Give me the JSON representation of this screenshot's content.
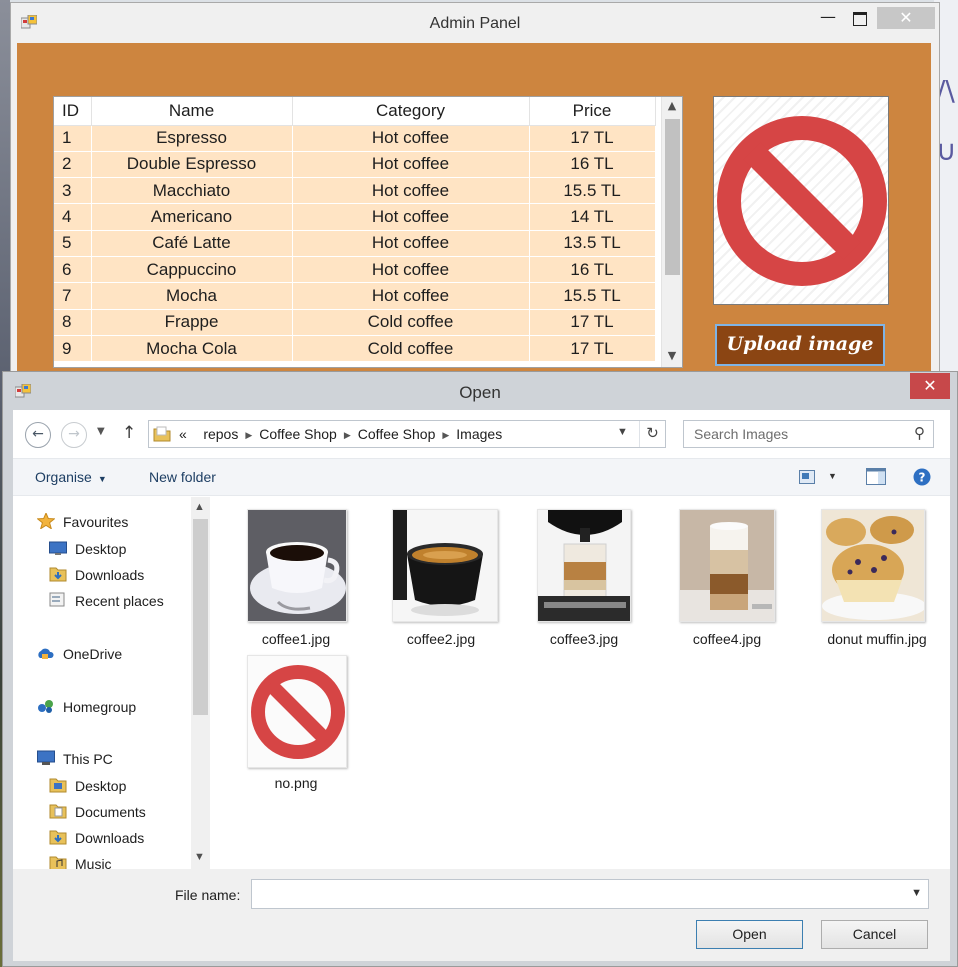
{
  "admin_window": {
    "title": "Admin Panel",
    "grid": {
      "columns": [
        "ID",
        "Name",
        "Category",
        "Price"
      ],
      "rows": [
        [
          "1",
          "Espresso",
          "Hot coffee",
          "17 TL"
        ],
        [
          "2",
          "Double Espresso",
          "Hot coffee",
          "16 TL"
        ],
        [
          "3",
          "Macchiato",
          "Hot coffee",
          "15.5 TL"
        ],
        [
          "4",
          "Americano",
          "Hot coffee",
          "14 TL"
        ],
        [
          "5",
          "Café Latte",
          "Hot coffee",
          "13.5 TL"
        ],
        [
          "6",
          "Cappuccino",
          "Hot coffee",
          "16 TL"
        ],
        [
          "7",
          "Mocha",
          "Hot coffee",
          "15.5 TL"
        ],
        [
          "8",
          "Frappe",
          "Cold coffee",
          "17 TL"
        ],
        [
          "9",
          "Mocha Cola",
          "Cold coffee",
          "17 TL"
        ]
      ]
    },
    "picture_icon": "no-entry-icon",
    "upload_label": "Upload image",
    "colors": {
      "panel": "#cd853f",
      "row": "#ffe4c4",
      "button": "#8b4513"
    }
  },
  "open_dialog": {
    "title": "Open",
    "breadcrumb": {
      "overflow": "«",
      "parts": [
        "repos",
        "Coffee Shop",
        "Coffee Shop",
        "Images"
      ]
    },
    "search_placeholder": "Search Images",
    "toolbar": {
      "organise": "Organise",
      "new_folder": "New folder"
    },
    "nav": {
      "favourites": "Favourites",
      "desktop": "Desktop",
      "downloads": "Downloads",
      "recent": "Recent places",
      "onedrive": "OneDrive",
      "homegroup": "Homegroup",
      "this_pc": "This PC",
      "pc_desktop": "Desktop",
      "pc_documents": "Documents",
      "pc_downloads": "Downloads",
      "pc_music": "Music"
    },
    "files": [
      {
        "name": "coffee1.jpg",
        "thumb": "coffee-cup-saucer"
      },
      {
        "name": "coffee2.jpg",
        "thumb": "espresso-cup-black"
      },
      {
        "name": "coffee3.jpg",
        "thumb": "coffee-machine-glass"
      },
      {
        "name": "coffee4.jpg",
        "thumb": "latte-glass"
      },
      {
        "name": "donut muffin.jpg",
        "thumb": "blueberry-muffins"
      },
      {
        "name": "no.png",
        "thumb": "no-entry-icon"
      }
    ],
    "file_name_label": "File name:",
    "file_name_value": "",
    "open_label": "Open",
    "cancel_label": "Cancel"
  }
}
